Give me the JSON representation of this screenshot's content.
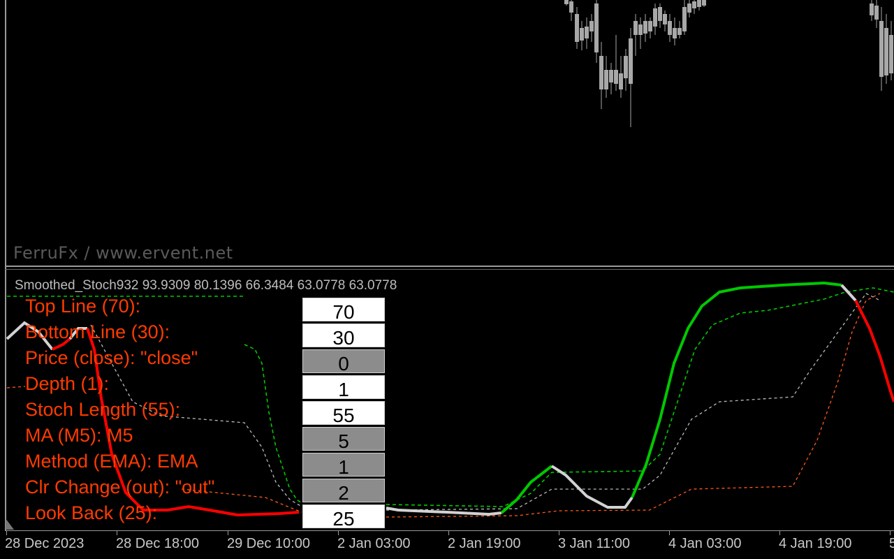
{
  "window": {
    "watermark": "FerruFx / www.ervent.net",
    "indicator_title": "Smoothed_Stoch932 93.9309 80.1396 66.3484 63.0778 63.0778"
  },
  "colors": {
    "background": "#000000",
    "frame": "#9a9a9a",
    "param_label": "#ff3b00",
    "line_up": "#00c800",
    "line_down": "#ff0000",
    "line_neutral": "#d2d2d2",
    "signal_green": "#00c800",
    "signal_grey": "#bbbbbb",
    "signal_orange": "#ff5a14",
    "candle": "#a8a8a8"
  },
  "parameters": [
    {
      "label": "Top Line (70):",
      "value": "70",
      "editable": true
    },
    {
      "label": "Bottom Line (30):",
      "value": "30",
      "editable": true
    },
    {
      "label": "Price (close): \"close\"",
      "value": "0",
      "editable": false
    },
    {
      "label": "Depth (1):",
      "value": "1",
      "editable": true
    },
    {
      "label": "Stoch Length (55):",
      "value": "55",
      "editable": true
    },
    {
      "label": "MA (M5): M5",
      "value": "5",
      "editable": false
    },
    {
      "label": "Method (EMA): EMA",
      "value": "1",
      "editable": false
    },
    {
      "label": "Clr Change (out): \"out\"",
      "value": "2",
      "editable": false
    },
    {
      "label": "Look Back (25):",
      "value": "25",
      "editable": true
    }
  ],
  "time_axis": {
    "labels": [
      "28 Dec 2023",
      "28 Dec 18:00",
      "29 Dec 10:00",
      "2 Jan 03:00",
      "2 Jan 19:00",
      "3 Jan 11:00",
      "4 Jan 03:00",
      "4 Jan 19:00",
      "5"
    ]
  }
}
